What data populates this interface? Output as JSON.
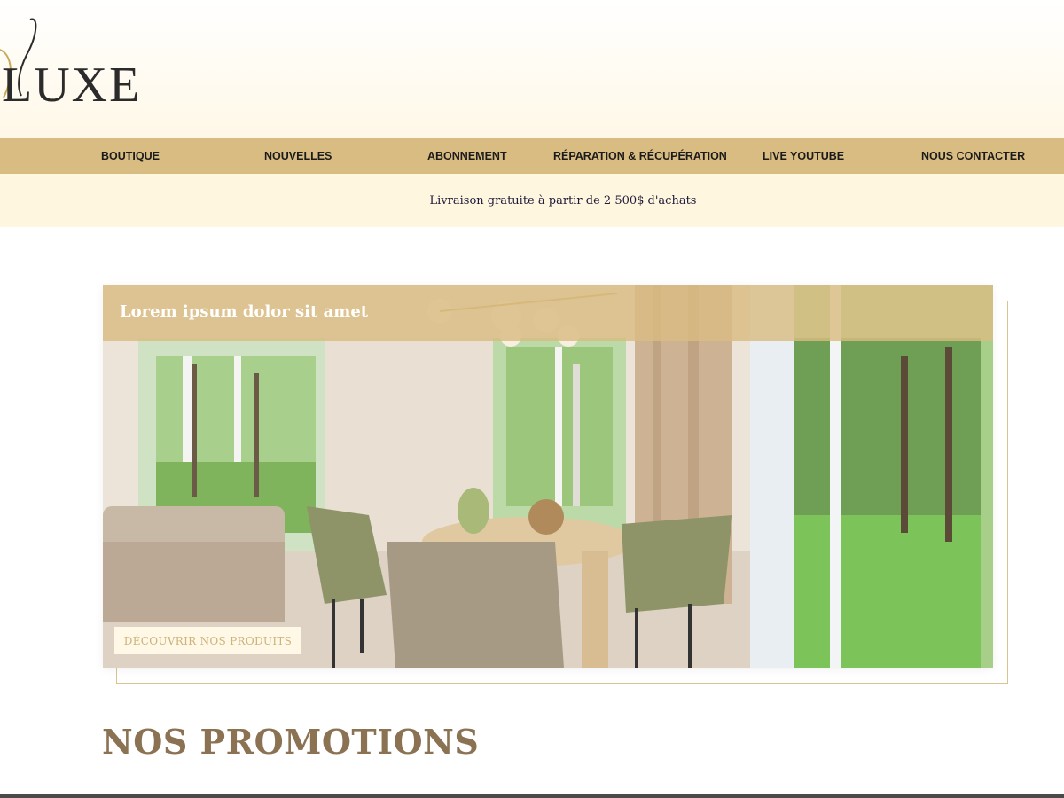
{
  "brand": {
    "logo_text": "LUXE"
  },
  "nav": {
    "items": [
      {
        "label": "BOUTIQUE"
      },
      {
        "label": "NOUVELLES"
      },
      {
        "label": "ABONNEMENT"
      },
      {
        "label": "RÉPARATION & RÉCUPÉRATION"
      },
      {
        "label": "LIVE YOUTUBE"
      },
      {
        "label": "NOUS CONTACTER"
      }
    ]
  },
  "announcement": {
    "text": "Livraison gratuite à partir de 2 500$ d'achats"
  },
  "hero": {
    "title": "Lorem ipsum dolor sit amet",
    "button_label": "DÉCOUVRIR NOS PRODUITS"
  },
  "promotions": {
    "title": "NOS PROMOTIONS"
  },
  "colors": {
    "nav_bg": "#d9bc81",
    "announce_bg": "#fff6df",
    "section_title": "#8b7253",
    "button_text": "#cdb27a"
  }
}
